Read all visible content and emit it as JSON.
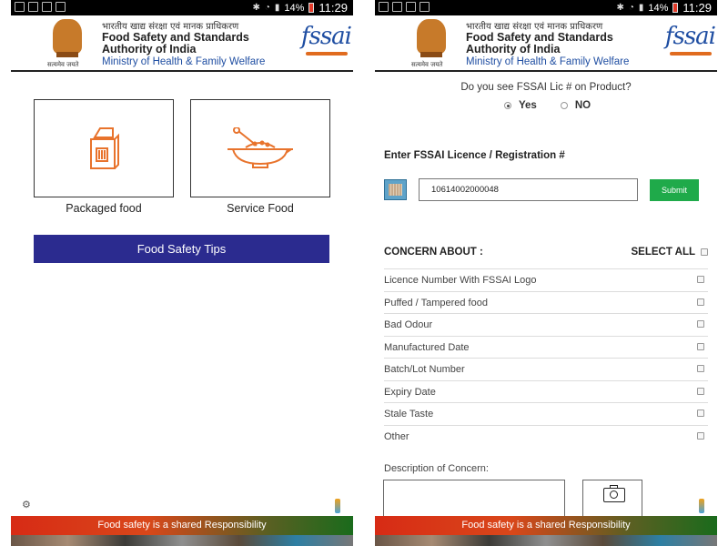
{
  "status_bar": {
    "battery": "14%",
    "time": "11:29"
  },
  "header": {
    "hindi_title": "भारतीय खाद्य संरक्षा एवं मानक प्राधिकरण",
    "title_line1": "Food Safety and Standards",
    "title_line2": "Authority of India",
    "ministry": "Ministry of Health & Family Welfare",
    "motto": "सत्यमेव जयते",
    "brand_logo": "fssai"
  },
  "home": {
    "tiles": [
      {
        "label": "Packaged food",
        "icon": "milk-carton-icon"
      },
      {
        "label": "Service Food",
        "icon": "food-plate-icon"
      }
    ],
    "tips_button": "Food Safety Tips",
    "accent_color": "#e8732c"
  },
  "complaint": {
    "question": "Do you see FSSAI Lic # on Product?",
    "options": [
      {
        "label": "Yes",
        "selected": true
      },
      {
        "label": "NO",
        "selected": false
      }
    ],
    "licence_title": "Enter FSSAI Licence / Registration #",
    "licence_value": "10614002000048",
    "submit_label": "Submit",
    "concern_heading": "CONCERN ABOUT :",
    "select_all_label": "SELECT ALL",
    "concerns": [
      "Licence Number With FSSAI Logo",
      "Puffed / Tampered food",
      "Bad Odour",
      "Manufactured Date",
      "Batch/Lot Number",
      "Expiry Date",
      "Stale Taste",
      "Other"
    ],
    "description_label": "Description of Concern:"
  },
  "banner": {
    "text": "Food safety is a shared Responsibility"
  },
  "colors": {
    "tips_button": "#2b2b8f",
    "submit_button": "#1faa4a",
    "ministry_text": "#1f4ea2",
    "banner_start": "#d72b15",
    "banner_end": "#1a6b1c"
  }
}
